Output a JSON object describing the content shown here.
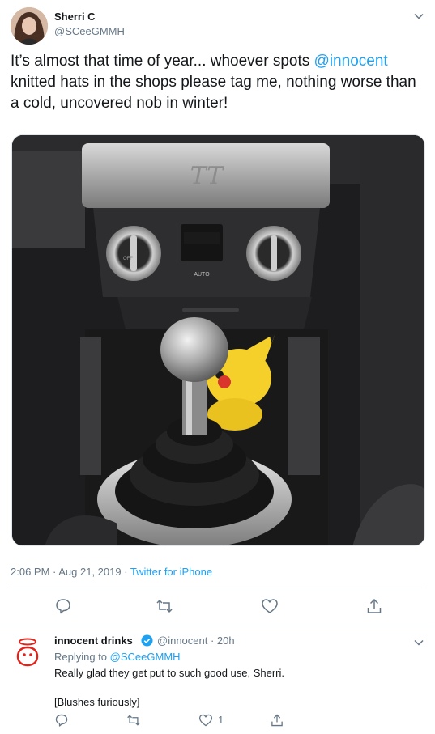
{
  "tweet": {
    "author_name": "Sherri C",
    "author_handle": "@SCeeGMMH",
    "text_before": "It’s almost that time of year... whoever spots ",
    "mention": "@innocent",
    "text_after": " knitted hats in the shops please tag me, nothing worse than a cold, uncovered nob in winter!",
    "timestamp": "2:06 PM · Aug 21, 2019 · ",
    "source": "Twitter for iPhone",
    "media_brand": "TT",
    "media_auto_label": "AUTO",
    "media_off_label": "OFF",
    "actions": {
      "reply_icon": "reply-icon",
      "retweet_icon": "retweet-icon",
      "like_icon": "heart-icon",
      "share_icon": "share-icon"
    }
  },
  "reply": {
    "author_name": "innocent drinks",
    "author_handle": "@innocent · 20h",
    "replying_prefix": "Replying to ",
    "replying_to": "@SCeeGMMH",
    "line1": "Really glad they get put to such good use, Sherri.",
    "line2": "[Blushes furiously]",
    "like_count": "1"
  },
  "colors": {
    "accent": "#1da1f2",
    "muted": "#657786",
    "text": "#14171a",
    "divider": "#e6ecf0",
    "brand_red": "#e2231a"
  }
}
